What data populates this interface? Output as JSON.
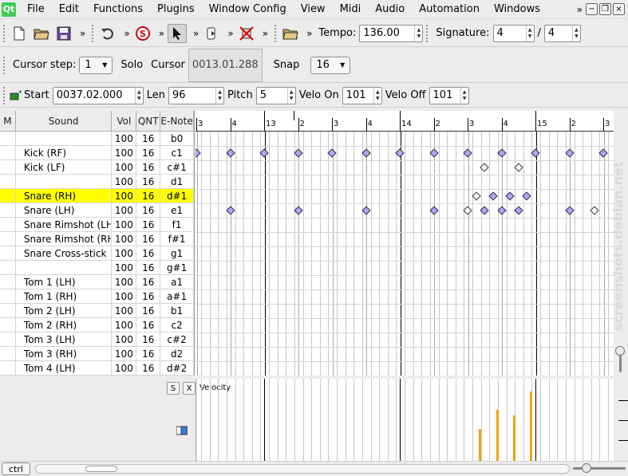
{
  "menubar": {
    "logo": "Qt",
    "items": [
      "File",
      "Edit",
      "Functions",
      "Plugins",
      "Window Config",
      "View",
      "Midi",
      "Audio",
      "Automation",
      "Windows"
    ],
    "overflow": "»"
  },
  "toolbar1": {
    "chev": "»",
    "tempo_label": "Tempo:",
    "tempo_value": "136.00",
    "signature_label": "Signature:",
    "sig_num": "4",
    "sig_sep": "/",
    "sig_den": "4"
  },
  "toolbar2": {
    "cursor_step_label": "Cursor step:",
    "cursor_step_value": "1",
    "solo_label": "Solo",
    "cursor_label": "Cursor",
    "cursor_value": "0013.01.288",
    "snap_label": "Snap",
    "snap_value": "16"
  },
  "toolbar3": {
    "start_label": "Start",
    "start_value": "0037.02.000",
    "len_label": "Len",
    "len_value": "96",
    "pitch_label": "Pitch",
    "pitch_value": "5",
    "velo_on_label": "Velo On",
    "velo_on_value": "101",
    "velo_off_label": "Velo Off",
    "velo_off_value": "101"
  },
  "drumlist": {
    "headers": [
      "M",
      "Sound",
      "Vol",
      "QNT",
      "E-Note"
    ],
    "rows": [
      {
        "sound": "",
        "vol": "100",
        "qnt": "16",
        "note": "b0"
      },
      {
        "sound": "Kick (RF)",
        "vol": "100",
        "qnt": "16",
        "note": "c1"
      },
      {
        "sound": "Kick (LF)",
        "vol": "100",
        "qnt": "16",
        "note": "c#1"
      },
      {
        "sound": "",
        "vol": "100",
        "qnt": "16",
        "note": "d1"
      },
      {
        "sound": "Snare (RH)",
        "vol": "100",
        "qnt": "16",
        "note": "d#1"
      },
      {
        "sound": "Snare (LH)",
        "vol": "100",
        "qnt": "16",
        "note": "e1"
      },
      {
        "sound": "Snare Rimshot (LH)",
        "vol": "100",
        "qnt": "16",
        "note": "f1"
      },
      {
        "sound": "Snare Rimshot (RH)",
        "vol": "100",
        "qnt": "16",
        "note": "f#1"
      },
      {
        "sound": "Snare Cross-stick",
        "vol": "100",
        "qnt": "16",
        "note": "g1"
      },
      {
        "sound": "",
        "vol": "100",
        "qnt": "16",
        "note": "g#1"
      },
      {
        "sound": "Tom 1 (LH)",
        "vol": "100",
        "qnt": "16",
        "note": "a1"
      },
      {
        "sound": "Tom 1 (RH)",
        "vol": "100",
        "qnt": "16",
        "note": "a#1"
      },
      {
        "sound": "Tom 2 (LH)",
        "vol": "100",
        "qnt": "16",
        "note": "b1"
      },
      {
        "sound": "Tom 2 (RH)",
        "vol": "100",
        "qnt": "16",
        "note": "c2"
      },
      {
        "sound": "Tom 3 (LH)",
        "vol": "100",
        "qnt": "16",
        "note": "c#2"
      },
      {
        "sound": "Tom 3 (RH)",
        "vol": "100",
        "qnt": "16",
        "note": "d2"
      },
      {
        "sound": "Tom 4 (LH)",
        "vol": "100",
        "qnt": "16",
        "note": "d#2"
      }
    ],
    "selected_index": 4,
    "selected_color": "#ffff00"
  },
  "ruler": {
    "labels": [
      "3",
      "4",
      "13",
      "2",
      "3",
      "4",
      "14",
      "2",
      "3",
      "4",
      "15",
      "2",
      "3"
    ]
  },
  "controller": {
    "s_label": "S",
    "x_label": "X",
    "name": "Velocity"
  },
  "bottombar": {
    "ctrl_label": "ctrl"
  },
  "colors": {
    "note_fill": "#a8a8ff",
    "velocity_bar": "#f0a500"
  },
  "watermark": "screenshots.debian.net"
}
